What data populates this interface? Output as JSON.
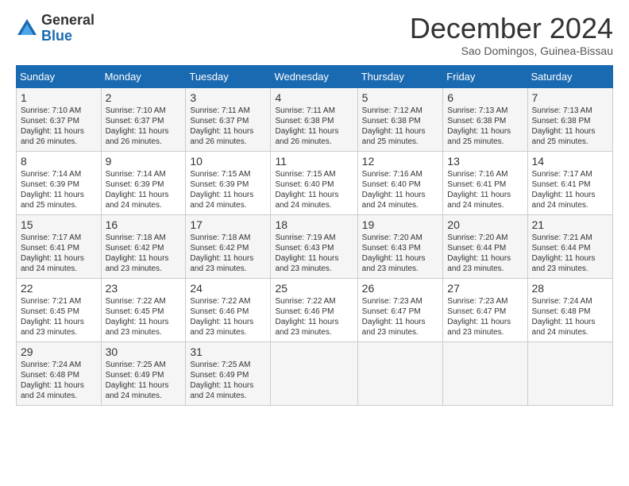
{
  "logo": {
    "general": "General",
    "blue": "Blue"
  },
  "header": {
    "month": "December 2024",
    "location": "Sao Domingos, Guinea-Bissau"
  },
  "days_of_week": [
    "Sunday",
    "Monday",
    "Tuesday",
    "Wednesday",
    "Thursday",
    "Friday",
    "Saturday"
  ],
  "weeks": [
    [
      {
        "day": "1",
        "sunrise": "7:10 AM",
        "sunset": "6:37 PM",
        "daylight": "11 hours and 26 minutes."
      },
      {
        "day": "2",
        "sunrise": "7:10 AM",
        "sunset": "6:37 PM",
        "daylight": "11 hours and 26 minutes."
      },
      {
        "day": "3",
        "sunrise": "7:11 AM",
        "sunset": "6:37 PM",
        "daylight": "11 hours and 26 minutes."
      },
      {
        "day": "4",
        "sunrise": "7:11 AM",
        "sunset": "6:38 PM",
        "daylight": "11 hours and 26 minutes."
      },
      {
        "day": "5",
        "sunrise": "7:12 AM",
        "sunset": "6:38 PM",
        "daylight": "11 hours and 25 minutes."
      },
      {
        "day": "6",
        "sunrise": "7:13 AM",
        "sunset": "6:38 PM",
        "daylight": "11 hours and 25 minutes."
      },
      {
        "day": "7",
        "sunrise": "7:13 AM",
        "sunset": "6:38 PM",
        "daylight": "11 hours and 25 minutes."
      }
    ],
    [
      {
        "day": "8",
        "sunrise": "7:14 AM",
        "sunset": "6:39 PM",
        "daylight": "11 hours and 25 minutes."
      },
      {
        "day": "9",
        "sunrise": "7:14 AM",
        "sunset": "6:39 PM",
        "daylight": "11 hours and 24 minutes."
      },
      {
        "day": "10",
        "sunrise": "7:15 AM",
        "sunset": "6:39 PM",
        "daylight": "11 hours and 24 minutes."
      },
      {
        "day": "11",
        "sunrise": "7:15 AM",
        "sunset": "6:40 PM",
        "daylight": "11 hours and 24 minutes."
      },
      {
        "day": "12",
        "sunrise": "7:16 AM",
        "sunset": "6:40 PM",
        "daylight": "11 hours and 24 minutes."
      },
      {
        "day": "13",
        "sunrise": "7:16 AM",
        "sunset": "6:41 PM",
        "daylight": "11 hours and 24 minutes."
      },
      {
        "day": "14",
        "sunrise": "7:17 AM",
        "sunset": "6:41 PM",
        "daylight": "11 hours and 24 minutes."
      }
    ],
    [
      {
        "day": "15",
        "sunrise": "7:17 AM",
        "sunset": "6:41 PM",
        "daylight": "11 hours and 24 minutes."
      },
      {
        "day": "16",
        "sunrise": "7:18 AM",
        "sunset": "6:42 PM",
        "daylight": "11 hours and 23 minutes."
      },
      {
        "day": "17",
        "sunrise": "7:18 AM",
        "sunset": "6:42 PM",
        "daylight": "11 hours and 23 minutes."
      },
      {
        "day": "18",
        "sunrise": "7:19 AM",
        "sunset": "6:43 PM",
        "daylight": "11 hours and 23 minutes."
      },
      {
        "day": "19",
        "sunrise": "7:20 AM",
        "sunset": "6:43 PM",
        "daylight": "11 hours and 23 minutes."
      },
      {
        "day": "20",
        "sunrise": "7:20 AM",
        "sunset": "6:44 PM",
        "daylight": "11 hours and 23 minutes."
      },
      {
        "day": "21",
        "sunrise": "7:21 AM",
        "sunset": "6:44 PM",
        "daylight": "11 hours and 23 minutes."
      }
    ],
    [
      {
        "day": "22",
        "sunrise": "7:21 AM",
        "sunset": "6:45 PM",
        "daylight": "11 hours and 23 minutes."
      },
      {
        "day": "23",
        "sunrise": "7:22 AM",
        "sunset": "6:45 PM",
        "daylight": "11 hours and 23 minutes."
      },
      {
        "day": "24",
        "sunrise": "7:22 AM",
        "sunset": "6:46 PM",
        "daylight": "11 hours and 23 minutes."
      },
      {
        "day": "25",
        "sunrise": "7:22 AM",
        "sunset": "6:46 PM",
        "daylight": "11 hours and 23 minutes."
      },
      {
        "day": "26",
        "sunrise": "7:23 AM",
        "sunset": "6:47 PM",
        "daylight": "11 hours and 23 minutes."
      },
      {
        "day": "27",
        "sunrise": "7:23 AM",
        "sunset": "6:47 PM",
        "daylight": "11 hours and 23 minutes."
      },
      {
        "day": "28",
        "sunrise": "7:24 AM",
        "sunset": "6:48 PM",
        "daylight": "11 hours and 24 minutes."
      }
    ],
    [
      {
        "day": "29",
        "sunrise": "7:24 AM",
        "sunset": "6:48 PM",
        "daylight": "11 hours and 24 minutes."
      },
      {
        "day": "30",
        "sunrise": "7:25 AM",
        "sunset": "6:49 PM",
        "daylight": "11 hours and 24 minutes."
      },
      {
        "day": "31",
        "sunrise": "7:25 AM",
        "sunset": "6:49 PM",
        "daylight": "11 hours and 24 minutes."
      },
      null,
      null,
      null,
      null
    ]
  ]
}
